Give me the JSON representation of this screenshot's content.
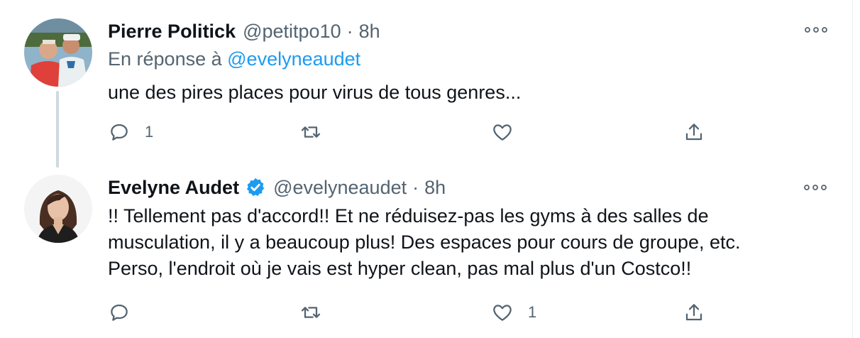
{
  "colors": {
    "text": "#0f1419",
    "secondary": "#536471",
    "accent": "#1d9bf0",
    "thread_line": "#cfd9de",
    "border": "#e6ecf0"
  },
  "tweets": [
    {
      "author_name": "Pierre Politick",
      "handle": "@petitpo10",
      "separator": "·",
      "time": "8h",
      "verified": false,
      "reply_prefix": "En réponse à",
      "reply_mention": "@evelyneaudet",
      "text_lines": [
        "une des pires places pour virus de tous genres..."
      ],
      "reply_count": "1",
      "retweet_count": "",
      "like_count": "",
      "icons": [
        "avatar-photo",
        "more-icon",
        "reply-icon",
        "retweet-icon",
        "like-icon",
        "share-icon"
      ]
    },
    {
      "author_name": "Evelyne Audet",
      "handle": "@evelyneaudet",
      "separator": "·",
      "time": "8h",
      "verified": true,
      "text_lines": [
        "!! Tellement pas d'accord!! Et ne réduisez-pas les gyms à des salles de",
        "musculation, il y a beaucoup plus! Des espaces pour cours de groupe, etc.",
        "Perso, l'endroit où je vais est hyper clean, pas mal plus d'un Costco!!"
      ],
      "reply_count": "",
      "retweet_count": "",
      "like_count": "1",
      "icons": [
        "avatar-photo",
        "verified-badge-icon",
        "more-icon",
        "reply-icon",
        "retweet-icon",
        "like-icon",
        "share-icon"
      ]
    }
  ]
}
